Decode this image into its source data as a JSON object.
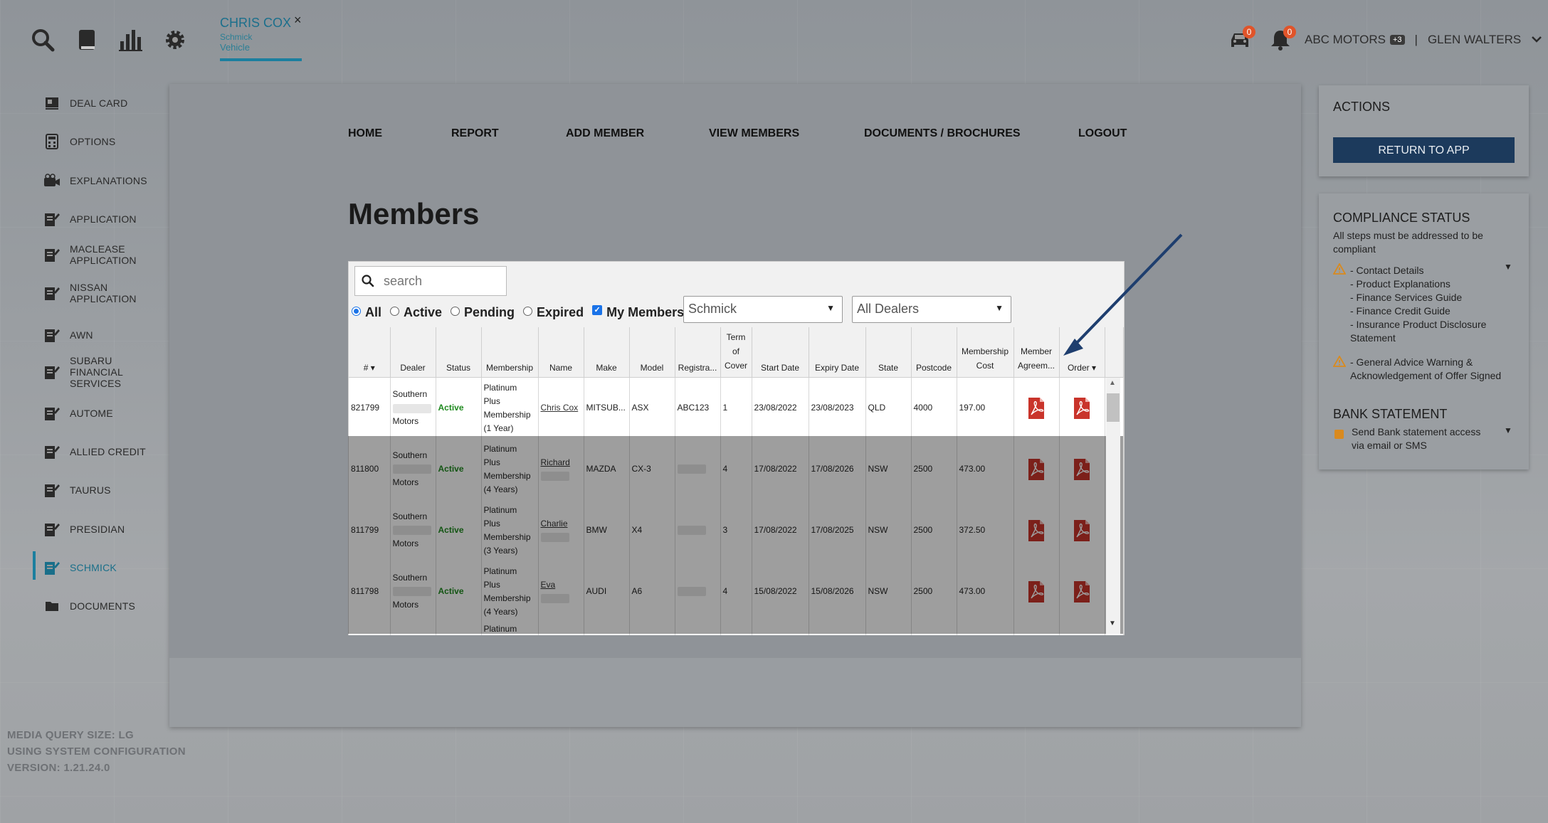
{
  "topbar": {
    "icons": [
      "search-icon",
      "book-icon",
      "bar-chart-icon",
      "gear-icon"
    ],
    "tab": {
      "name": "CHRIS COX",
      "line1": "Schmick",
      "line2": "Vehicle",
      "close": "×"
    },
    "car_badge": "0",
    "bell_badge": "0",
    "dealer": "ABC MOTORS",
    "dealer_extra": "+3",
    "separator": "|",
    "user": "GLEN WALTERS"
  },
  "sidebar": {
    "items": [
      {
        "label": "DEAL CARD",
        "icon": "deal-card-icon"
      },
      {
        "label": "OPTIONS",
        "icon": "calculator-icon"
      },
      {
        "label": "EXPLANATIONS",
        "icon": "video-icon"
      },
      {
        "label": "APPLICATION",
        "icon": "form-icon"
      },
      {
        "label": "MACLEASE\nAPPLICATION",
        "icon": "form-icon"
      },
      {
        "label": "NISSAN\nAPPLICATION",
        "icon": "form-icon"
      },
      {
        "label": "AWN",
        "icon": "form-icon"
      },
      {
        "label": "SUBARU\nFINANCIAL\nSERVICES",
        "icon": "form-icon"
      },
      {
        "label": "AUTOME",
        "icon": "form-icon"
      },
      {
        "label": "ALLIED CREDIT",
        "icon": "form-icon"
      },
      {
        "label": "TAURUS",
        "icon": "form-icon"
      },
      {
        "label": "PRESIDIAN",
        "icon": "form-icon"
      },
      {
        "label": "SCHMICK",
        "icon": "form-icon"
      },
      {
        "label": "DOCUMENTS",
        "icon": "folder-icon"
      }
    ]
  },
  "nav": {
    "home": "HOME",
    "report": "REPORT",
    "add_member": "ADD MEMBER",
    "view_members": "VIEW MEMBERS",
    "documents": "DOCUMENTS / BROCHURES",
    "logout": "LOGOUT"
  },
  "page": {
    "title": "Members"
  },
  "members": {
    "search_placeholder": "search",
    "filters": {
      "all": "All",
      "active": "Active",
      "pending": "Pending",
      "expired": "Expired",
      "my_members": "My Members"
    },
    "selected_filter": "All",
    "my_members_checked": true,
    "provider_select": "Schmick",
    "dealer_select": "All Dealers",
    "columns": [
      "#",
      "Dealer",
      "Status",
      "Membership",
      "Name",
      "Make",
      "Model",
      "Registra...",
      "Term of Cover",
      "Start Date",
      "Expiry Date",
      "State",
      "Postcode",
      "Membership Cost",
      "Member Agreem...",
      "Order"
    ],
    "sort_col_hash": "▾",
    "sort_col_order": "▾",
    "rows": [
      {
        "id": "821799",
        "dealer_a": "Southern",
        "dealer_b": "Motors",
        "status": "Active",
        "membership": "Platinum Plus Membership (1 Year)",
        "name": "Chris Cox",
        "name2": "",
        "make": "MITSUB...",
        "model": "ASX",
        "rego": "ABC123",
        "term": "1",
        "start": "23/08/2022",
        "expiry": "23/08/2023",
        "state": "QLD",
        "postcode": "4000",
        "cost": "197.00"
      },
      {
        "id": "811800",
        "dealer_a": "Southern",
        "dealer_b": "Motors",
        "status": "Active",
        "membership": "Platinum Plus Membership (4 Years)",
        "name": "Richard",
        "name2": "",
        "make": "MAZDA",
        "model": "CX-3",
        "rego": "",
        "term": "4",
        "start": "17/08/2022",
        "expiry": "17/08/2026",
        "state": "NSW",
        "postcode": "2500",
        "cost": "473.00"
      },
      {
        "id": "811799",
        "dealer_a": "Southern",
        "dealer_b": "Motors",
        "status": "Active",
        "membership": "Platinum Plus Membership (3 Years)",
        "name": "Charlie",
        "name2": "",
        "make": "BMW",
        "model": "X4",
        "rego": "",
        "term": "3",
        "start": "17/08/2022",
        "expiry": "17/08/2025",
        "state": "NSW",
        "postcode": "2500",
        "cost": "372.50"
      },
      {
        "id": "811798",
        "dealer_a": "Southern",
        "dealer_b": "Motors",
        "status": "Active",
        "membership": "Platinum Plus Membership (4 Years)",
        "name": "Eva",
        "name2": "",
        "make": "AUDI",
        "model": "A6",
        "rego": "",
        "term": "4",
        "start": "15/08/2022",
        "expiry": "15/08/2026",
        "state": "NSW",
        "postcode": "2500",
        "cost": "473.00"
      }
    ],
    "partial_row": "Platinum"
  },
  "actions": {
    "title": "ACTIONS",
    "return_button": "RETURN TO APP"
  },
  "compliance": {
    "title": "COMPLIANCE STATUS",
    "subtitle": "All steps must be addressed to be compliant",
    "group1": [
      "- Contact Details",
      "- Product Explanations",
      "- Finance Services Guide",
      "- Finance Credit Guide",
      "- Insurance Product Disclosure Statement"
    ],
    "group2": [
      "- General Advice Warning & Acknowledgement of Offer Signed"
    ]
  },
  "bank": {
    "title": "BANK STATEMENT",
    "text": "Send Bank statement access via email or SMS"
  },
  "footer": {
    "line1": "MEDIA QUERY SIZE: LG",
    "line2": "USING SYSTEM CONFIGURATION",
    "line3": "VERSION: 1.21.24.0"
  },
  "colors": {
    "accent": "#1b7f9f",
    "button": "#1c3a5c",
    "active_status": "#1f8a1f",
    "warning": "#d98a1e",
    "badge": "#e0542a"
  }
}
